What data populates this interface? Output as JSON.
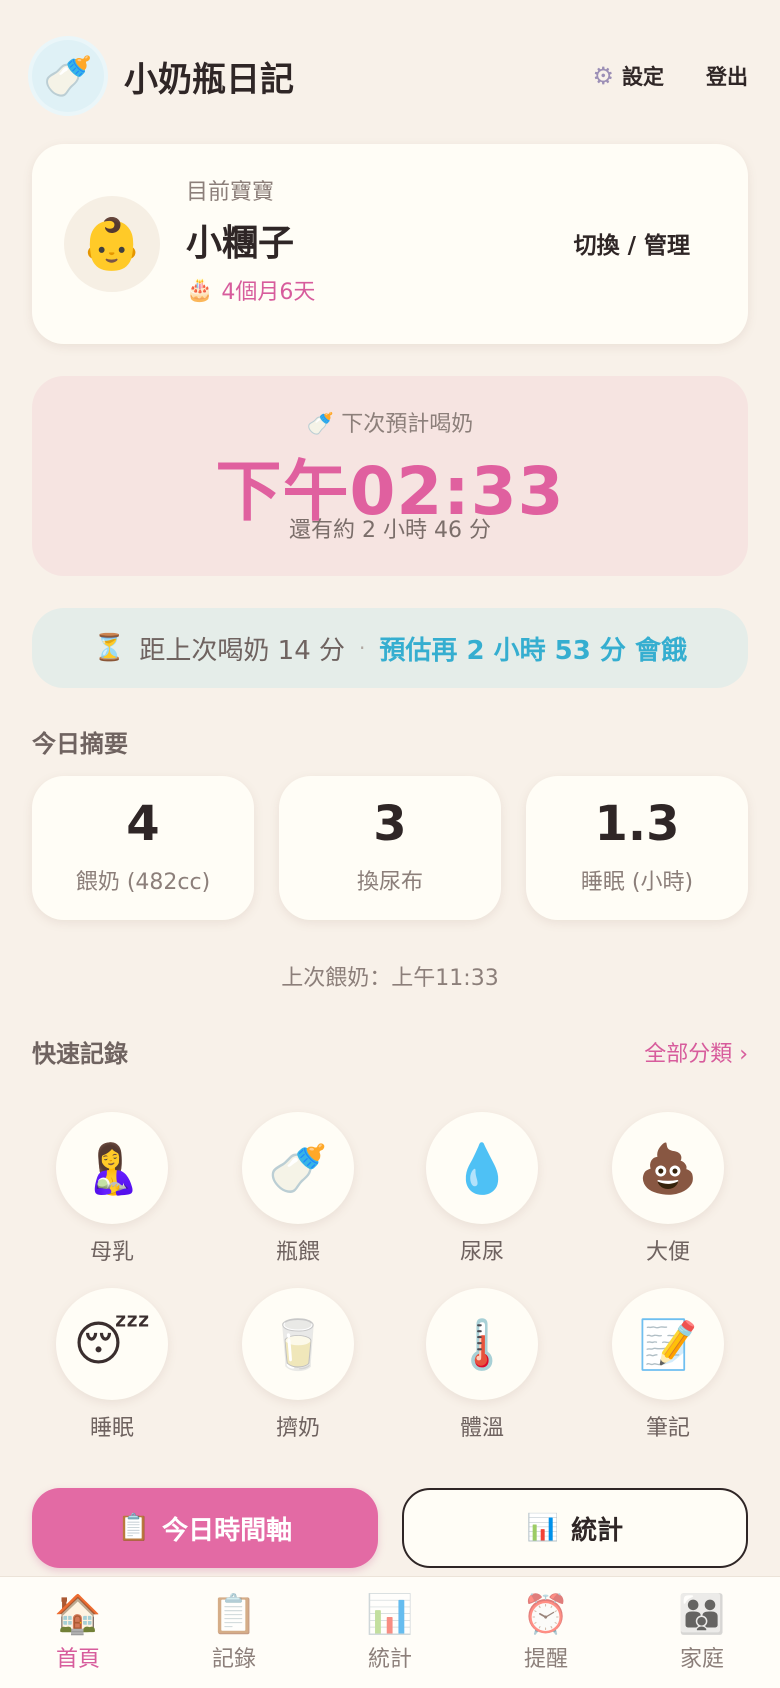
{
  "header": {
    "app_title": "小奶瓶日記",
    "logo_icon": "baby-bottle-mascot",
    "settings_label": "設定",
    "logout_label": "登出"
  },
  "baby": {
    "label": "目前寶寶",
    "name": "小糰子",
    "age": "4個月6天",
    "switch_label": "切換 / 管理"
  },
  "next_feed": {
    "label": "下次預計喝奶",
    "time": "下午02:33",
    "remaining": "還有約 2 小時 46 分"
  },
  "since_last": {
    "text": "距上次喝奶 14 分",
    "separator": "·",
    "estimate": "預估再 2 小時 53 分 會餓"
  },
  "summary": {
    "title": "今日摘要",
    "stats": [
      {
        "value": "4",
        "label": "餵奶 (482cc)"
      },
      {
        "value": "3",
        "label": "換尿布"
      },
      {
        "value": "1.3",
        "label": "睡眠 (小時)"
      }
    ],
    "last_feed": "上次餵奶：上午11:33"
  },
  "quick": {
    "title": "快速記錄",
    "see_all": "全部分類 ›",
    "items": [
      {
        "label": "母乳",
        "icon": "breastfeeding-icon"
      },
      {
        "label": "瓶餵",
        "icon": "baby-bottle-icon"
      },
      {
        "label": "尿尿",
        "icon": "droplet-icon"
      },
      {
        "label": "大便",
        "icon": "poop-icon"
      },
      {
        "label": "睡眠",
        "icon": "sleeping-face-icon"
      },
      {
        "label": "擠奶",
        "icon": "glass-of-milk-icon"
      },
      {
        "label": "體溫",
        "icon": "thermometer-icon"
      },
      {
        "label": "筆記",
        "icon": "note-icon"
      }
    ]
  },
  "actions": {
    "timeline_label": "今日時間軸",
    "stats_label": "統計"
  },
  "nav": {
    "items": [
      {
        "label": "首頁",
        "icon": "house-icon"
      },
      {
        "label": "記錄",
        "icon": "clipboard-icon"
      },
      {
        "label": "統計",
        "icon": "bar-chart-icon"
      },
      {
        "label": "提醒",
        "icon": "alarm-clock-icon"
      },
      {
        "label": "家庭",
        "icon": "family-icon"
      }
    ]
  },
  "colors": {
    "accent_pink": "#e36aa4",
    "accent_blue": "#35aed0",
    "background": "#f8f1e9"
  }
}
